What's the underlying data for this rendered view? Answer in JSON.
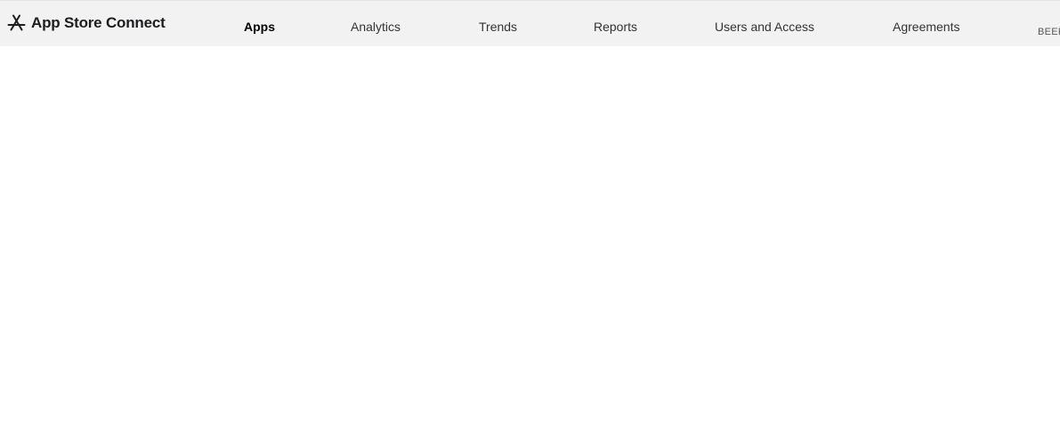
{
  "header": {
    "brand": {
      "title": "App Store Connect",
      "icon": "app-store-icon"
    },
    "nav": [
      {
        "label": "Apps",
        "active": true
      },
      {
        "label": "Analytics",
        "active": false
      },
      {
        "label": "Trends",
        "active": false
      },
      {
        "label": "Reports",
        "active": false
      },
      {
        "label": "Users and Access",
        "active": false
      },
      {
        "label": "Agreements",
        "active": false
      }
    ],
    "account": {
      "label": "BEEF"
    }
  },
  "colors": {
    "header_bg": "#f2f2f2",
    "active_text": "#000000",
    "nav_text": "#333333"
  }
}
